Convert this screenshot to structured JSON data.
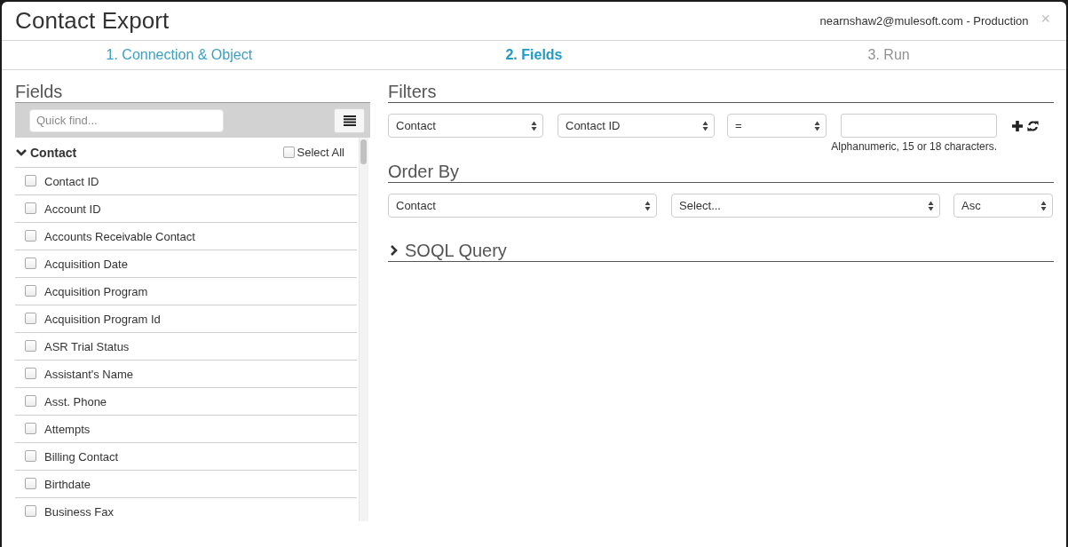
{
  "window": {
    "title": "Contact Export",
    "account": "nearnshaw2@mulesoft.com - Production",
    "close": "×"
  },
  "steps": [
    {
      "label": "1. Connection & Object",
      "selected": false,
      "disabled": false
    },
    {
      "label": "2. Fields",
      "selected": true,
      "disabled": false
    },
    {
      "label": "3. Run",
      "selected": false,
      "disabled": true
    }
  ],
  "fields_panel": {
    "title": "Fields",
    "search": {
      "placeholder": "Quick find..."
    },
    "group": {
      "label": "Contact",
      "expanded": true,
      "select_all": {
        "label": "Select All",
        "checked": false
      },
      "items": [
        {
          "label": "Contact ID",
          "checked": false
        },
        {
          "label": "Account ID",
          "checked": false
        },
        {
          "label": "Accounts Receivable Contact",
          "checked": false
        },
        {
          "label": "Acquisition Date",
          "checked": false
        },
        {
          "label": "Acquisition Program",
          "checked": false
        },
        {
          "label": "Acquisition Program Id",
          "checked": false
        },
        {
          "label": "ASR Trial Status",
          "checked": false
        },
        {
          "label": "Assistant's Name",
          "checked": false
        },
        {
          "label": "Asst. Phone",
          "checked": false
        },
        {
          "label": "Attempts",
          "checked": false
        },
        {
          "label": "Billing Contact",
          "checked": false
        },
        {
          "label": "Birthdate",
          "checked": false
        },
        {
          "label": "Business Fax",
          "checked": false
        }
      ]
    }
  },
  "filters": {
    "title": "Filters",
    "object": "Contact",
    "field": "Contact ID",
    "operator": "=",
    "hint": "Alphanumeric, 15 or 18 characters."
  },
  "order_by": {
    "title": "Order By",
    "object": "Contact",
    "field": "Select...",
    "direction": "Asc"
  },
  "soql": {
    "title": "SOQL Query",
    "expanded": false
  }
}
